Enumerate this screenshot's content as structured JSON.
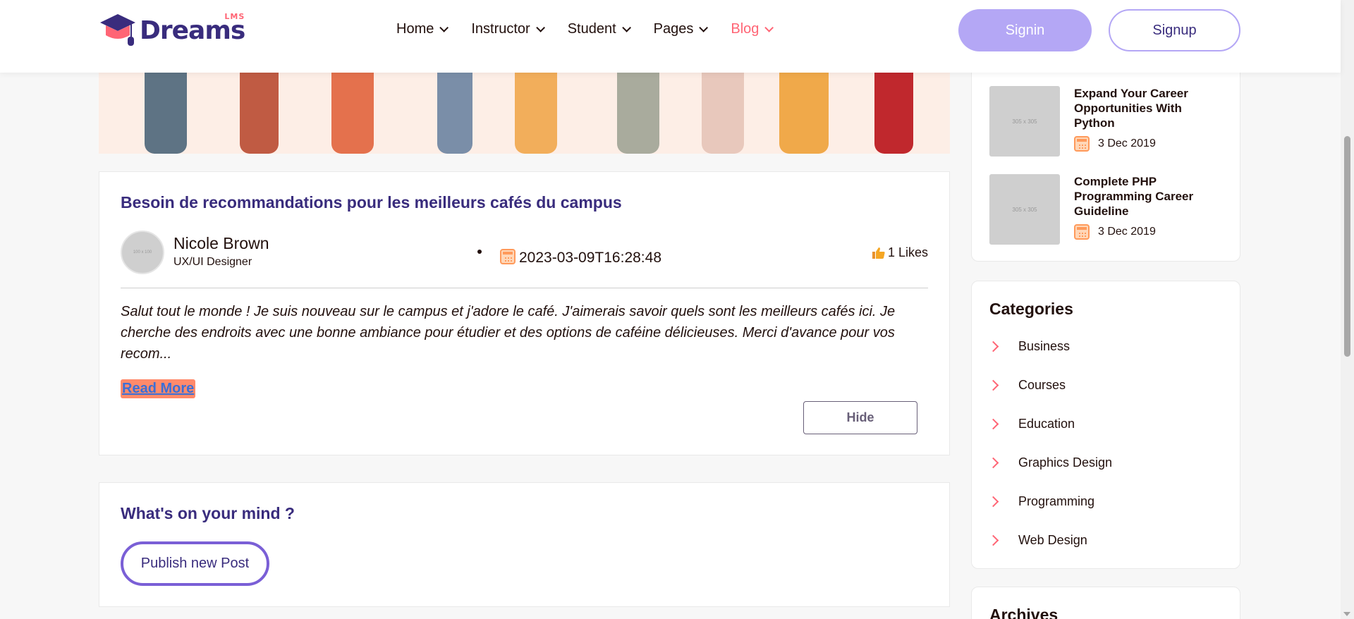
{
  "header": {
    "logo_text": "Dreams",
    "logo_sup": "LMS",
    "nav": [
      {
        "label": "Home"
      },
      {
        "label": "Instructor"
      },
      {
        "label": "Student"
      },
      {
        "label": "Pages"
      },
      {
        "label": "Blog"
      }
    ],
    "signin_label": "Signin",
    "signup_label": "Signup"
  },
  "post": {
    "title": "Besoin de recommandations pour les meilleurs cafés du campus",
    "avatar_placeholder": "100 x 100",
    "author_name": "Nicole Brown",
    "author_role": "UX/UI Designer",
    "date": "2023-03-09T16:28:48",
    "likes": "1 Likes",
    "excerpt": "Salut tout le monde ! Je suis nouveau sur le campus et j'adore le café. J'aimerais savoir quels sont les meilleurs cafés ici. Je cherche des endroits avec une bonne ambiance pour étudier et des options de caféine délicieuses. Merci d'avance pour vos recom...",
    "read_more": "Read More",
    "hide_label": "Hide"
  },
  "mind": {
    "title": "What's on your mind ?",
    "publish_label": "Publish new Post"
  },
  "recent_posts": [
    {
      "thumb": "305 x 305",
      "title": "Expand Your Career Opportunities With Python",
      "date": "3 Dec 2019"
    },
    {
      "thumb": "305 x 305",
      "title": "Complete PHP Programming Career Guideline",
      "date": "3 Dec 2019"
    }
  ],
  "categories": {
    "title": "Categories",
    "items": [
      "Business",
      "Courses",
      "Education",
      "Graphics Design",
      "Programming",
      "Web Design"
    ]
  },
  "archives": {
    "title": "Archives"
  },
  "colors": {
    "brand": "#392c7d",
    "accent": "#ff6575",
    "signin_bg": "#b4a7f5"
  }
}
